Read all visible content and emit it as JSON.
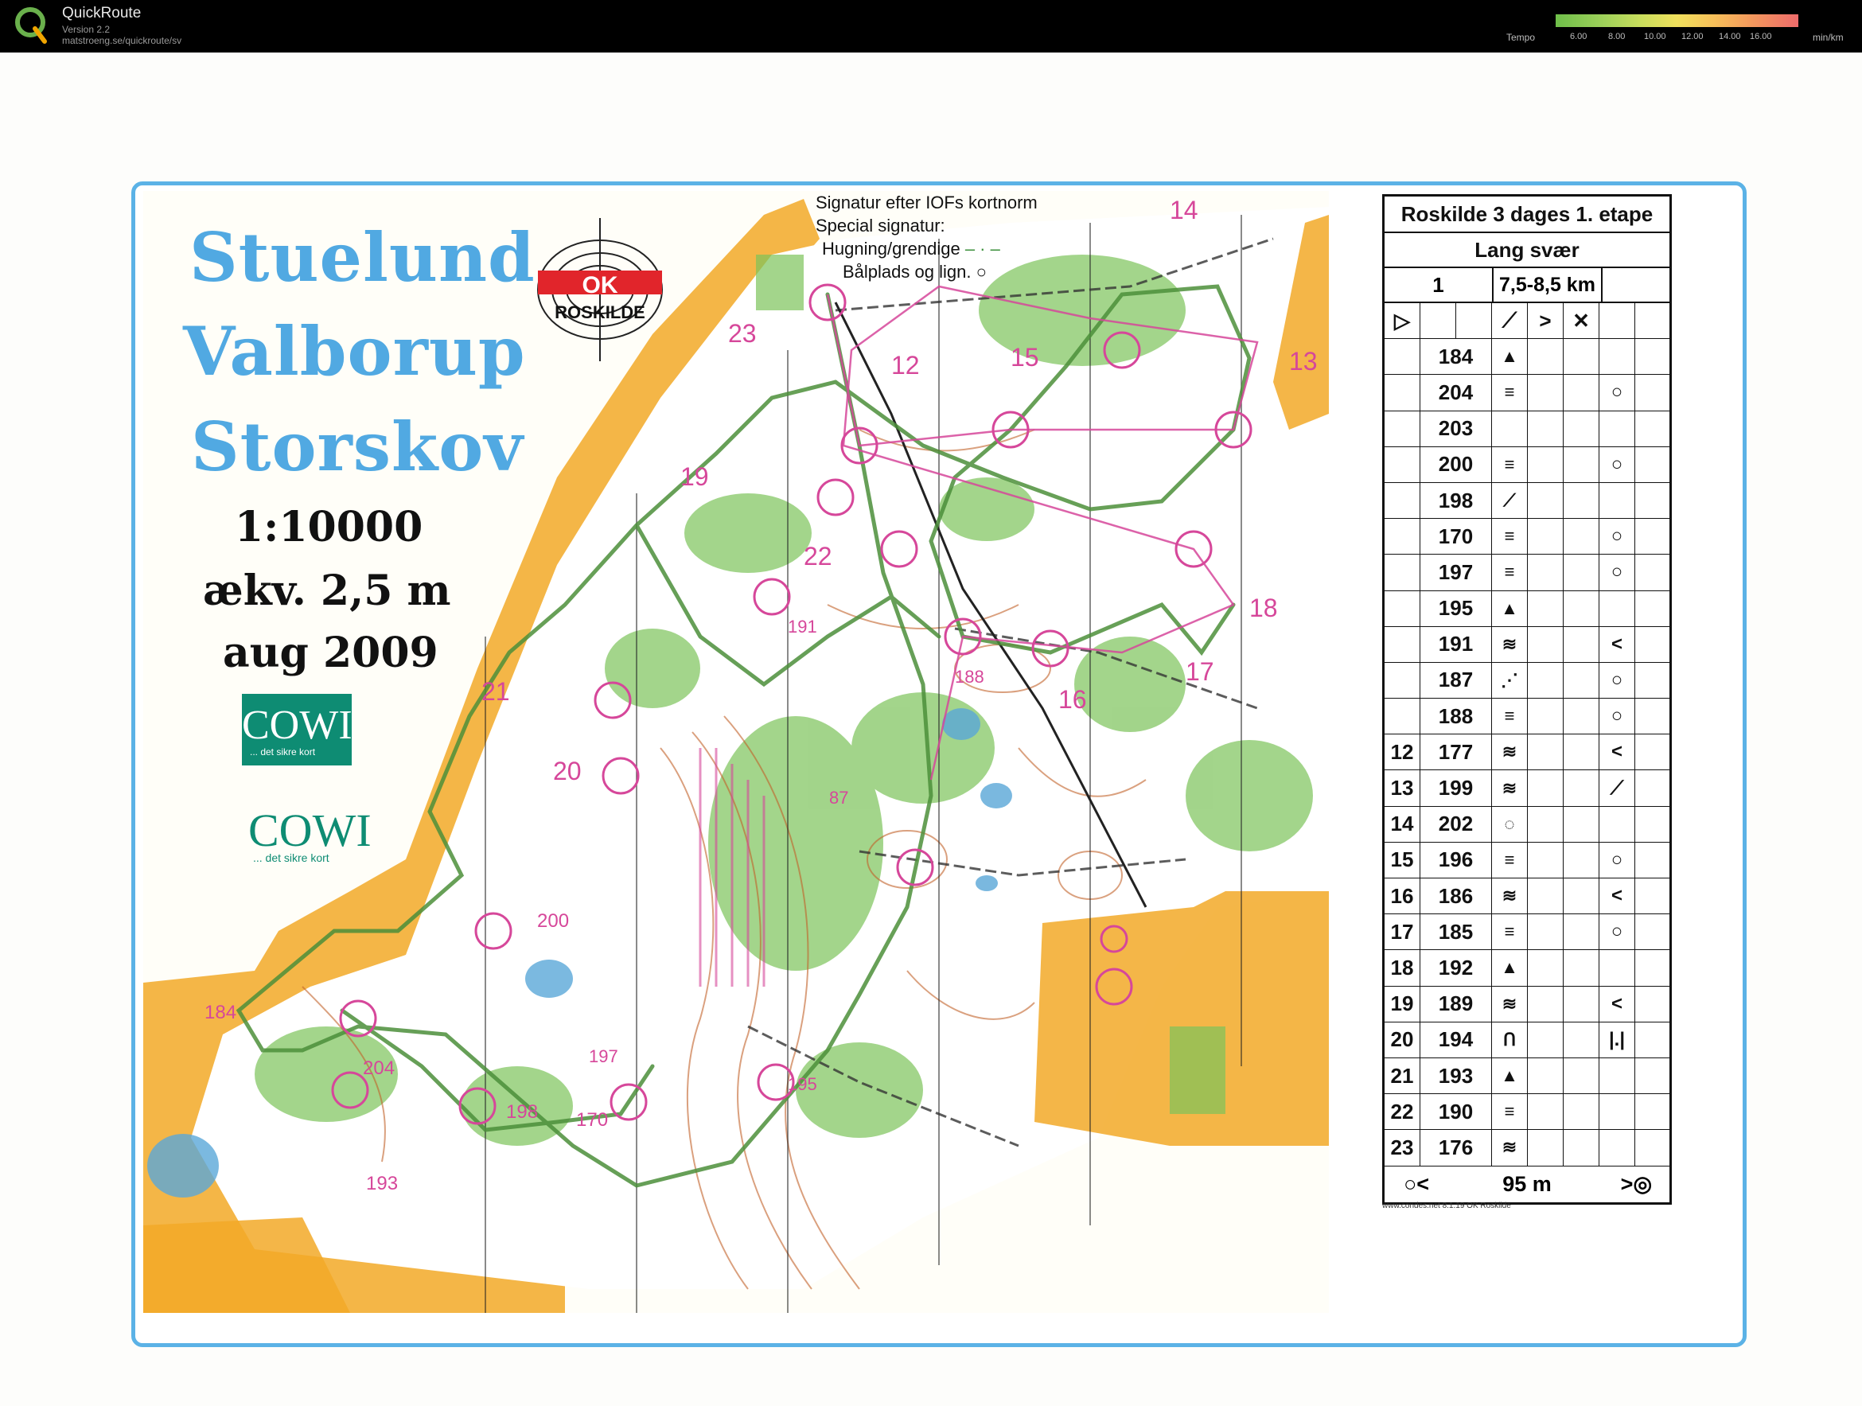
{
  "app": {
    "name": "QuickRoute",
    "version": "Version 2.2",
    "url": "matstroeng.se/quickroute/sv"
  },
  "tempo": {
    "label": "Tempo",
    "ticks": [
      "6.00",
      "8.00",
      "10.00",
      "12.00",
      "14.00",
      "16.00"
    ],
    "unit": "min/km",
    "colors": [
      "#6fbf4a",
      "#c9de5c",
      "#f0e05c",
      "#f39a5c",
      "#ee6b6b"
    ]
  },
  "map": {
    "title_lines": [
      "Stuelund",
      "Valborup",
      "Storskov"
    ],
    "scale": "1:10000",
    "contour": "ækv. 2,5 m",
    "date": "aug 2009",
    "club_name": "ROSKILDE",
    "club_badge": "OK",
    "sponsor": "COWI",
    "sponsor_tagline": "... det sikre kort",
    "legend": [
      "Signatur efter IOFs kortnorm",
      "Special signatur:",
      "Hugning/grendige",
      "Bålplads og lign."
    ],
    "control_labels": [
      "14",
      "13",
      "15",
      "12",
      "23",
      "19",
      "22",
      "191",
      "18",
      "17",
      "16",
      "188",
      "21",
      "20",
      "87",
      "200",
      "184",
      "204",
      "198",
      "170",
      "197",
      "195",
      "193"
    ],
    "colors": {
      "frame": "#5bb2e6",
      "forest": "#7cc35a",
      "open": "#f2a928",
      "course": "#d6479a",
      "contour": "#c2622a",
      "water": "#5aa7d8"
    }
  },
  "control_descriptions": {
    "title": "Roskilde 3 dages 1. etape",
    "class": "Lang svær",
    "course_number": "1",
    "course_length": "7,5-8,5 km",
    "controls": [
      {
        "num": "",
        "code": "184"
      },
      {
        "num": "",
        "code": "204"
      },
      {
        "num": "",
        "code": "203"
      },
      {
        "num": "",
        "code": "200"
      },
      {
        "num": "",
        "code": "198"
      },
      {
        "num": "",
        "code": "170"
      },
      {
        "num": "",
        "code": "197"
      },
      {
        "num": "",
        "code": "195"
      },
      {
        "num": "",
        "code": "191"
      },
      {
        "num": "",
        "code": "187"
      },
      {
        "num": "",
        "code": "188"
      },
      {
        "num": "12",
        "code": "177"
      },
      {
        "num": "13",
        "code": "199"
      },
      {
        "num": "14",
        "code": "202"
      },
      {
        "num": "15",
        "code": "196"
      },
      {
        "num": "16",
        "code": "186"
      },
      {
        "num": "17",
        "code": "185"
      },
      {
        "num": "18",
        "code": "192"
      },
      {
        "num": "19",
        "code": "189"
      },
      {
        "num": "20",
        "code": "194"
      },
      {
        "num": "21",
        "code": "193"
      },
      {
        "num": "22",
        "code": "190"
      },
      {
        "num": "23",
        "code": "176"
      }
    ],
    "finish_distance": "95 m",
    "footer": "www.condes.net 8.1.19 OK Roskilde"
  }
}
